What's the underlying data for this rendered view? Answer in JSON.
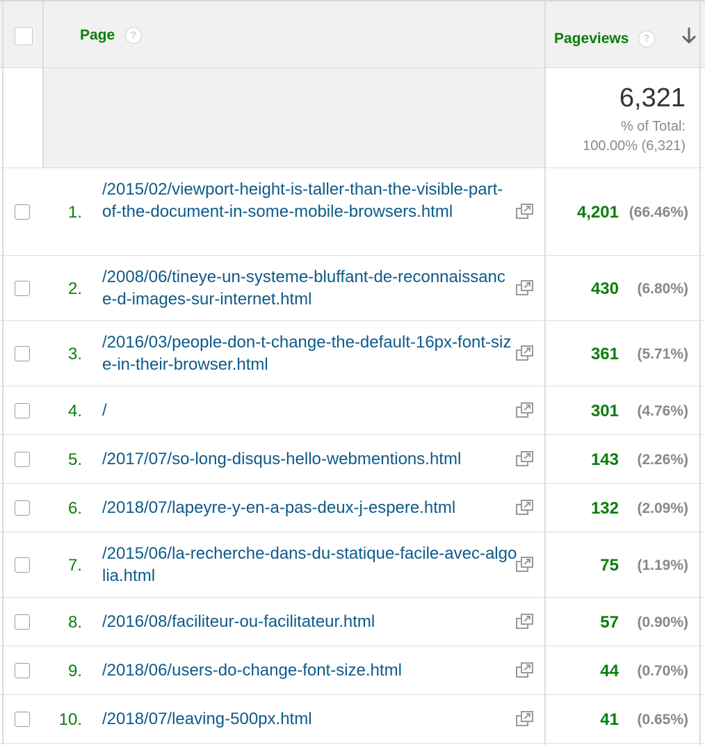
{
  "header": {
    "page_label": "Page",
    "help_glyph": "?",
    "pageviews_label": "Pageviews",
    "sort_icon": "arrow-down-icon"
  },
  "summary": {
    "total": "6,321",
    "pct_label": "% of Total:",
    "pct_value": "100.00% (6,321)"
  },
  "rows": [
    {
      "rank": "1.",
      "page": "/2015/02/viewport-height-is-taller-than-the-visible-part-of-the-document-in-some-mobile-browsers.html",
      "pageviews": "4,201",
      "pct": "(66.46%)"
    },
    {
      "rank": "2.",
      "page": "/2008/06/tineye-un-systeme-bluffant-de-reconnaissance-d-images-sur-internet.html",
      "pageviews": "430",
      "pct": "(6.80%)"
    },
    {
      "rank": "3.",
      "page": "/2016/03/people-don-t-change-the-default-16px-font-size-in-their-browser.html",
      "pageviews": "361",
      "pct": "(5.71%)"
    },
    {
      "rank": "4.",
      "page": "/",
      "pageviews": "301",
      "pct": "(4.76%)"
    },
    {
      "rank": "5.",
      "page": "/2017/07/so-long-disqus-hello-webmentions.html",
      "pageviews": "143",
      "pct": "(2.26%)"
    },
    {
      "rank": "6.",
      "page": "/2018/07/lapeyre-y-en-a-pas-deux-j-espere.html",
      "pageviews": "132",
      "pct": "(2.09%)"
    },
    {
      "rank": "7.",
      "page": "/2015/06/la-recherche-dans-du-statique-facile-avec-algolia.html",
      "pageviews": "75",
      "pct": "(1.19%)"
    },
    {
      "rank": "8.",
      "page": "/2016/08/faciliteur-ou-facilitateur.html",
      "pageviews": "57",
      "pct": "(0.90%)"
    },
    {
      "rank": "9.",
      "page": "/2018/06/users-do-change-font-size.html",
      "pageviews": "44",
      "pct": "(0.70%)"
    },
    {
      "rank": "10.",
      "page": "/2018/07/leaving-500px.html",
      "pageviews": "41",
      "pct": "(0.65%)"
    }
  ],
  "colors": {
    "rank_green": "#0b7d0b",
    "link_blue": "#0d5a8a",
    "header_bg": "#f1f1f1",
    "border": "#dcdcdc"
  },
  "icons": {
    "row_action": "open-in-new-window-icon",
    "help": "help-icon"
  }
}
